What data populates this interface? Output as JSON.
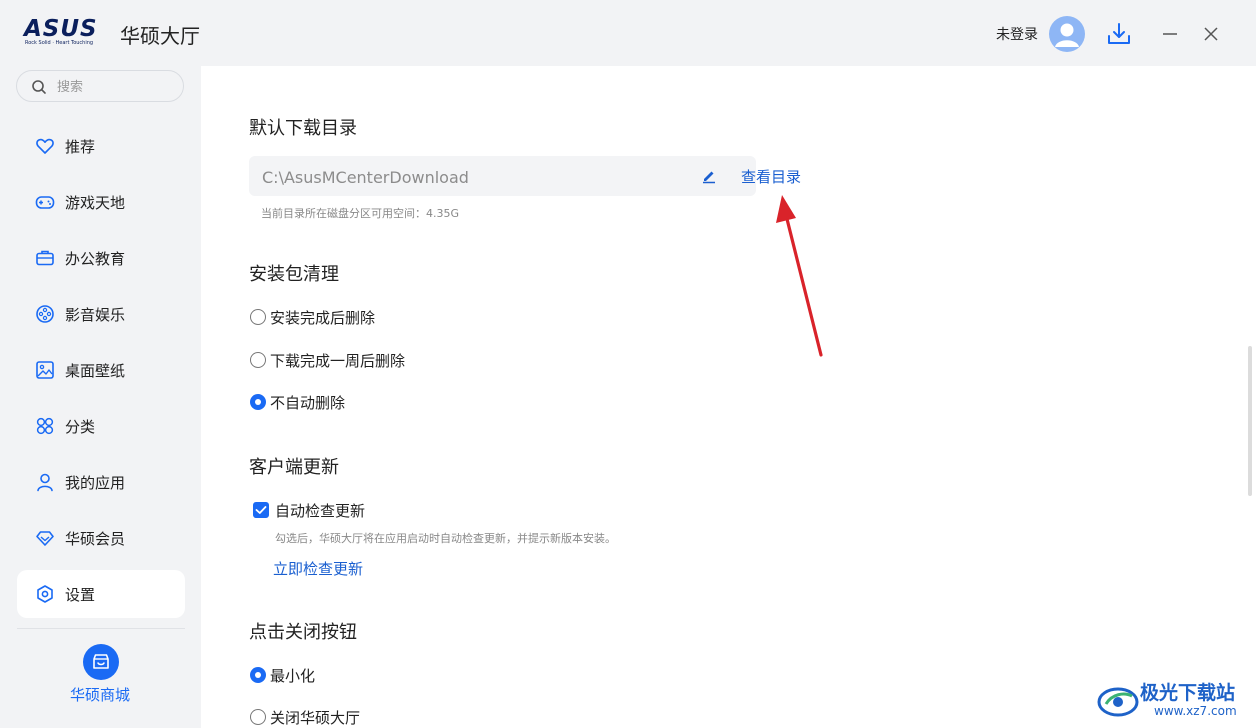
{
  "app": {
    "logo_word": "ASUS",
    "logo_tagline": "Rock Solid · Heart Touching",
    "title": "华硕大厅",
    "login_status": "未登录"
  },
  "sidebar": {
    "search_placeholder": "搜索",
    "items": [
      {
        "label": "推荐",
        "icon": "heart-icon"
      },
      {
        "label": "游戏天地",
        "icon": "gamepad-icon"
      },
      {
        "label": "办公教育",
        "icon": "briefcase-icon"
      },
      {
        "label": "影音娱乐",
        "icon": "film-reel-icon"
      },
      {
        "label": "桌面壁纸",
        "icon": "image-icon"
      },
      {
        "label": "分类",
        "icon": "grid-icon"
      },
      {
        "label": "我的应用",
        "icon": "user-icon"
      },
      {
        "label": "华硕会员",
        "icon": "diamond-icon"
      },
      {
        "label": "设置",
        "icon": "settings-icon",
        "active": true
      }
    ],
    "store_label": "华硕商城"
  },
  "settings": {
    "download_dir": {
      "title": "默认下载目录",
      "path": "C:\\AsusMCenterDownload",
      "view_link": "查看目录",
      "space_hint": "当前目录所在磁盘分区可用空间：4.35G"
    },
    "package_cleanup": {
      "title": "安装包清理",
      "options": [
        {
          "label": "安装完成后删除",
          "checked": false
        },
        {
          "label": "下载完成一周后删除",
          "checked": false
        },
        {
          "label": "不自动删除",
          "checked": true
        }
      ]
    },
    "client_update": {
      "title": "客户端更新",
      "auto_check_label": "自动检查更新",
      "auto_check_checked": true,
      "hint": "勾选后，华硕大厅将在应用启动时自动检查更新，并提示新版本安装。",
      "check_now": "立即检查更新"
    },
    "close_button": {
      "title": "点击关闭按钮",
      "options": [
        {
          "label": "最小化",
          "checked": true
        },
        {
          "label": "关闭华硕大厅",
          "checked": false
        }
      ]
    }
  },
  "watermark": {
    "text": "极光下载站",
    "url": "www.xz7.com"
  },
  "colors": {
    "accent": "#1a6af4",
    "link": "#1a5fd0",
    "annotation_arrow": "#d9232a"
  }
}
